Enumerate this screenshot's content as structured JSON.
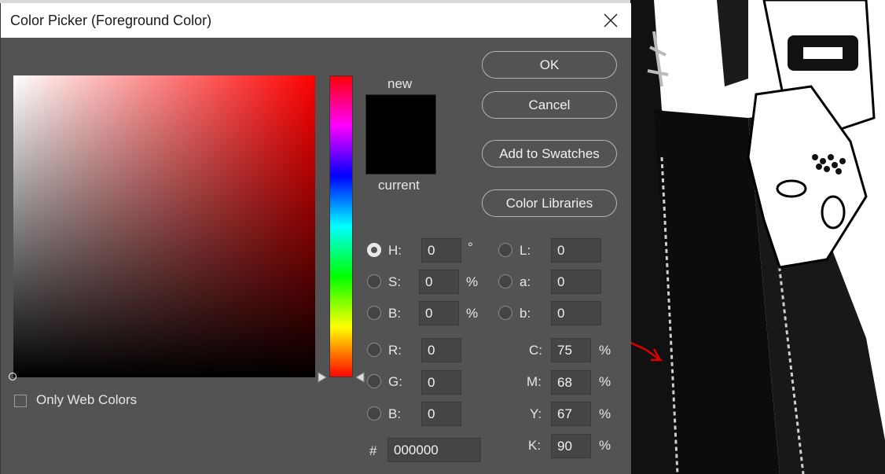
{
  "dialog": {
    "title": "Color Picker (Foreground Color)",
    "new_label": "new",
    "current_label": "current",
    "new_color": "#000000",
    "current_color": "#000000"
  },
  "buttons": {
    "ok": "OK",
    "cancel": "Cancel",
    "add_to_swatches": "Add to Swatches",
    "color_libraries": "Color Libraries"
  },
  "hsb": {
    "h_label": "H:",
    "h_value": "0",
    "h_unit": "°",
    "s_label": "S:",
    "s_value": "0",
    "s_unit": "%",
    "b_label": "B:",
    "b_value": "0",
    "b_unit": "%"
  },
  "rgb": {
    "r_label": "R:",
    "r_value": "0",
    "g_label": "G:",
    "g_value": "0",
    "b_label": "B:",
    "b_value": "0"
  },
  "lab": {
    "l_label": "L:",
    "l_value": "0",
    "a_label": "a:",
    "a_value": "0",
    "b_label": "b:",
    "b_value": "0"
  },
  "cmyk": {
    "c_label": "C:",
    "c_value": "75",
    "m_label": "M:",
    "m_value": "68",
    "y_label": "Y:",
    "y_value": "67",
    "k_label": "K:",
    "k_value": "90",
    "unit": "%"
  },
  "hex": {
    "label": "#",
    "value": "000000"
  },
  "web_colors": {
    "label": "Only Web Colors",
    "checked": false
  },
  "selected_mode": "H",
  "colors": {
    "dialog_bg": "#535353",
    "input_bg": "#454545",
    "title_bg": "#ffffff"
  }
}
